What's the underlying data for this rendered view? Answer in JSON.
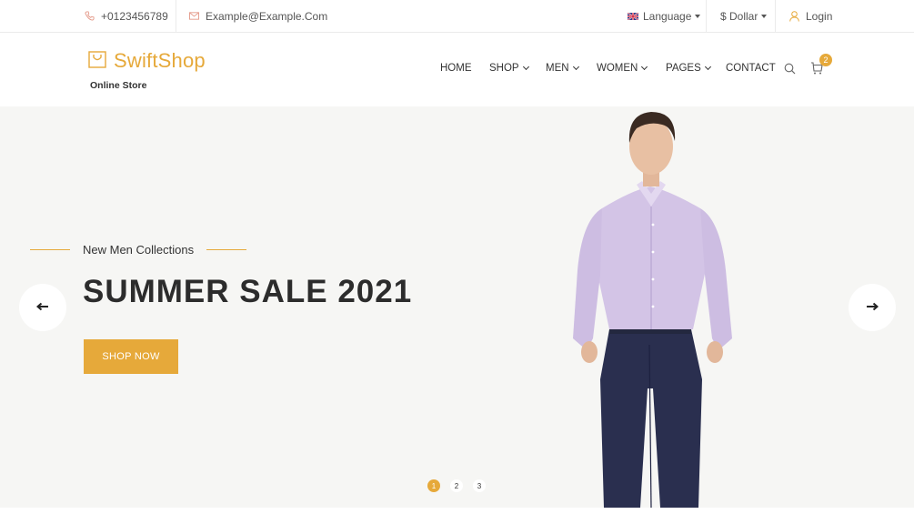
{
  "topbar": {
    "phone": "+0123456789",
    "email": "Example@Example.Com",
    "language_label": "Language",
    "currency_label": "$ Dollar",
    "login_label": "Login"
  },
  "header": {
    "logo_title": "SwiftShop",
    "logo_subtitle": "Online Store",
    "nav": {
      "home": "HOME",
      "shop": "SHOP",
      "men": "MEN",
      "women": "WOMEN",
      "pages": "PAGES",
      "contact": "CONTACT"
    },
    "cart_count": "2"
  },
  "hero": {
    "subheading": "New Men Collections",
    "title": "SUMMER SALE 2021",
    "button_label": "SHOP NOW",
    "dots": [
      "1",
      "2",
      "3"
    ],
    "active_dot": 1
  },
  "colors": {
    "accent": "#e6a93a",
    "hero_bg": "#f6f6f4",
    "title": "#2c2c2c"
  },
  "icons": [
    "phone-icon",
    "mail-icon",
    "uk-flag-icon",
    "user-icon",
    "shopping-bag-logo-icon",
    "search-icon",
    "cart-icon",
    "arrow-left-icon",
    "arrow-right-icon"
  ]
}
